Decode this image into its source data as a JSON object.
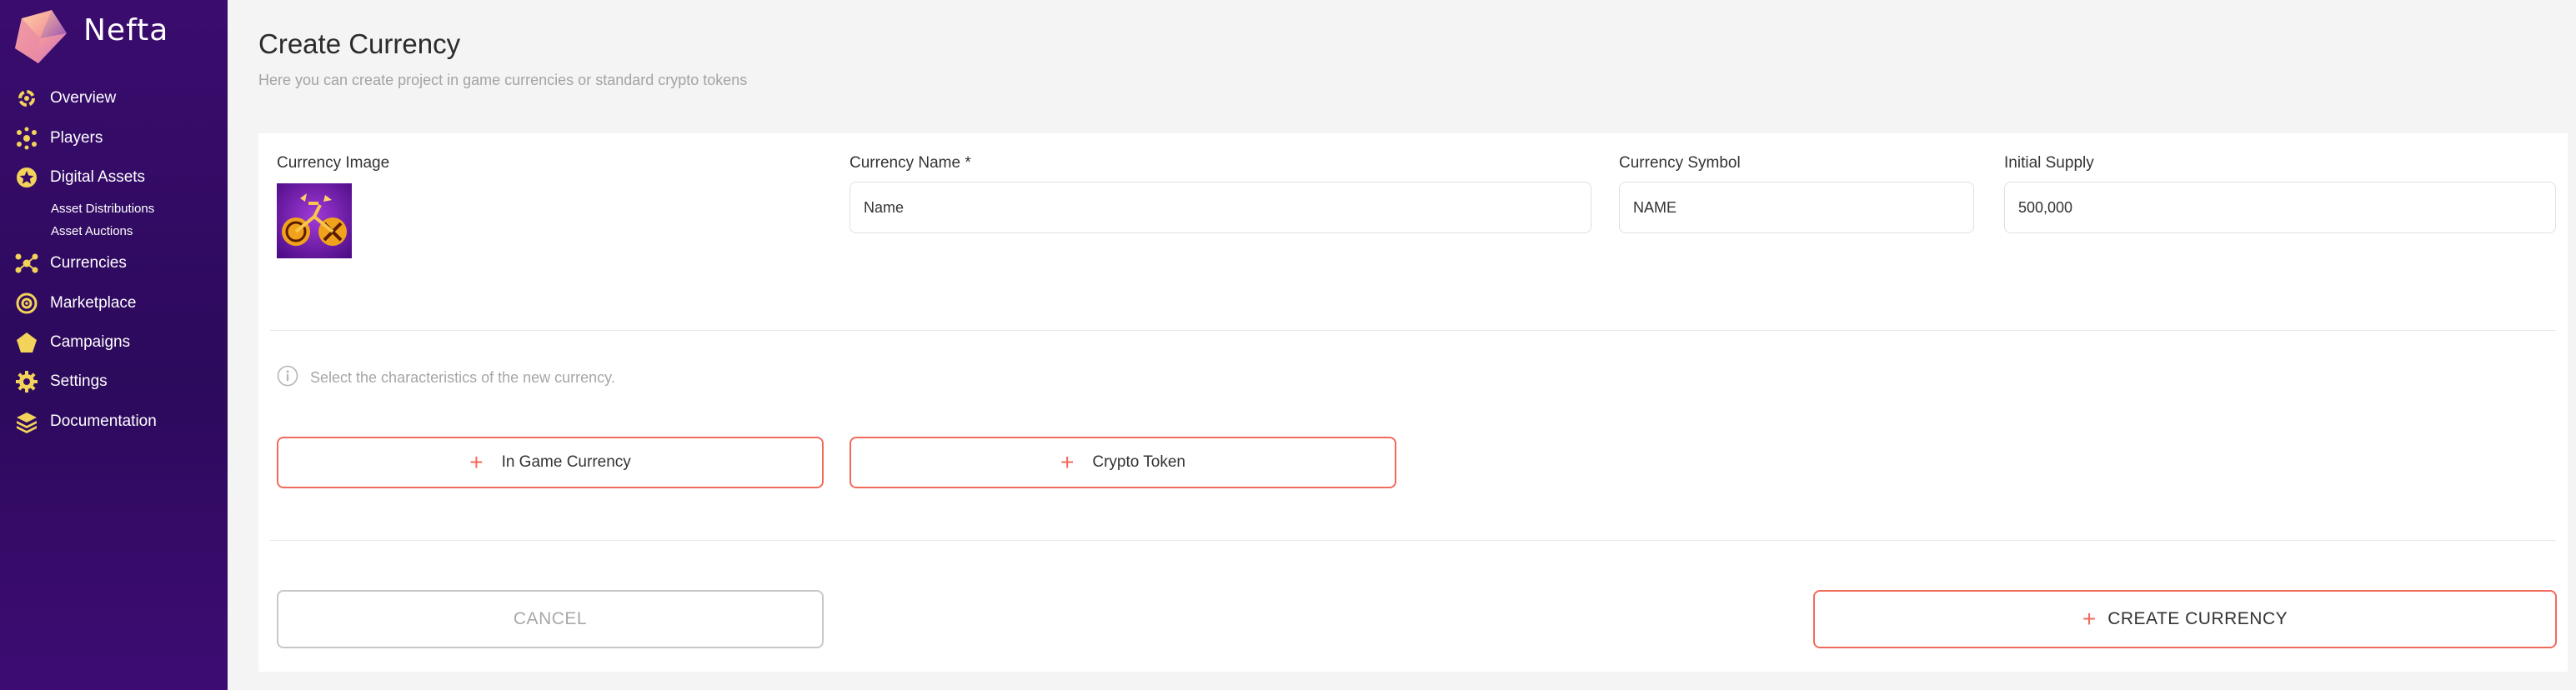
{
  "app": {
    "name": "Nefta"
  },
  "sidebar": {
    "items": [
      {
        "label": "Overview",
        "icon": "overview-icon"
      },
      {
        "label": "Players",
        "icon": "players-icon"
      },
      {
        "label": "Digital Assets",
        "icon": "digital-assets-icon"
      },
      {
        "label": "Currencies",
        "icon": "currencies-icon"
      },
      {
        "label": "Marketplace",
        "icon": "marketplace-icon"
      },
      {
        "label": "Campaigns",
        "icon": "campaigns-icon"
      },
      {
        "label": "Settings",
        "icon": "gear-icon"
      },
      {
        "label": "Documentation",
        "icon": "documentation-icon"
      }
    ],
    "sub_items": [
      {
        "label": "Asset Distributions"
      },
      {
        "label": "Asset Auctions"
      }
    ]
  },
  "header": {
    "title": "Create Currency",
    "subtitle": "Here you can create project in game currencies or standard crypto tokens"
  },
  "form": {
    "image_label": "Currency Image",
    "name_label": "Currency Name *",
    "name_value": "Name",
    "symbol_label": "Currency Symbol",
    "symbol_value": "NAME",
    "supply_label": "Initial Supply",
    "supply_value": "500,000",
    "info_text": "Select the characteristics of the new currency.",
    "option_in_game": "In Game Currency",
    "option_crypto": "Crypto Token",
    "cancel_label": "CANCEL",
    "create_label": "CREATE CURRENCY"
  },
  "colors": {
    "sidebar": "#2c0a5c",
    "accent": "#f26a5c",
    "icon_gold": "#f3d35a"
  }
}
